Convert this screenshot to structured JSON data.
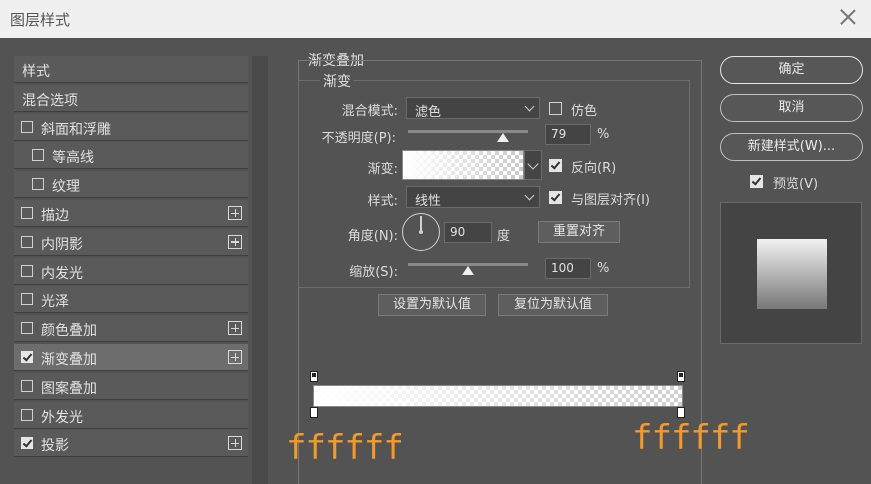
{
  "window": {
    "title": "图层样式"
  },
  "left_list": {
    "items": [
      {
        "label": "样式",
        "checkbox": false,
        "checked": false,
        "plus": false,
        "indent": false,
        "selected": false
      },
      {
        "label": "混合选项",
        "checkbox": false,
        "checked": false,
        "plus": false,
        "indent": false,
        "selected": false
      },
      {
        "label": "斜面和浮雕",
        "checkbox": true,
        "checked": false,
        "plus": false,
        "indent": false,
        "selected": false
      },
      {
        "label": "等高线",
        "checkbox": true,
        "checked": false,
        "plus": false,
        "indent": true,
        "selected": false
      },
      {
        "label": "纹理",
        "checkbox": true,
        "checked": false,
        "plus": false,
        "indent": true,
        "selected": false
      },
      {
        "label": "描边",
        "checkbox": true,
        "checked": false,
        "plus": true,
        "indent": false,
        "selected": false
      },
      {
        "label": "内阴影",
        "checkbox": true,
        "checked": false,
        "plus": true,
        "indent": false,
        "selected": false
      },
      {
        "label": "内发光",
        "checkbox": true,
        "checked": false,
        "plus": false,
        "indent": false,
        "selected": false
      },
      {
        "label": "光泽",
        "checkbox": true,
        "checked": false,
        "plus": false,
        "indent": false,
        "selected": false
      },
      {
        "label": "颜色叠加",
        "checkbox": true,
        "checked": false,
        "plus": true,
        "indent": false,
        "selected": false
      },
      {
        "label": "渐变叠加",
        "checkbox": true,
        "checked": true,
        "plus": true,
        "indent": false,
        "selected": true
      },
      {
        "label": "图案叠加",
        "checkbox": true,
        "checked": false,
        "plus": false,
        "indent": false,
        "selected": false
      },
      {
        "label": "外发光",
        "checkbox": true,
        "checked": false,
        "plus": false,
        "indent": false,
        "selected": false
      },
      {
        "label": "投影",
        "checkbox": true,
        "checked": true,
        "plus": true,
        "indent": false,
        "selected": false
      }
    ]
  },
  "gradient_overlay": {
    "section_title": "渐变叠加",
    "group_title": "渐变",
    "blend_mode": {
      "label": "混合模式:",
      "value": "滤色"
    },
    "dither": {
      "label": "仿色",
      "checked": false
    },
    "opacity": {
      "label": "不透明度(P):",
      "value": "79",
      "unit": "%",
      "fraction": 0.79
    },
    "gradient": {
      "label": "渐变:"
    },
    "reverse": {
      "label": "反向(R)",
      "checked": true
    },
    "style": {
      "label": "样式:",
      "value": "线性"
    },
    "align_with_layer": {
      "label": "与图层对齐(I)",
      "checked": true
    },
    "angle": {
      "label": "角度(N):",
      "value": "90",
      "unit": "度"
    },
    "reset_alignment": "重置对齐",
    "scale": {
      "label": "缩放(S):",
      "value": "100",
      "unit": "%",
      "fraction": 0.5
    },
    "set_default": "设置为默认值",
    "reset_default": "复位为默认值"
  },
  "gradient_editor": {
    "left_hex": "ffffff",
    "right_hex": "ffffff"
  },
  "right_panel": {
    "ok": "确定",
    "cancel": "取消",
    "new_style": "新建样式(W)...",
    "preview": {
      "label": "预览(V)",
      "checked": true
    }
  },
  "colors": {
    "accent_orange": "#f29a2e",
    "panel_bg": "#535353"
  }
}
